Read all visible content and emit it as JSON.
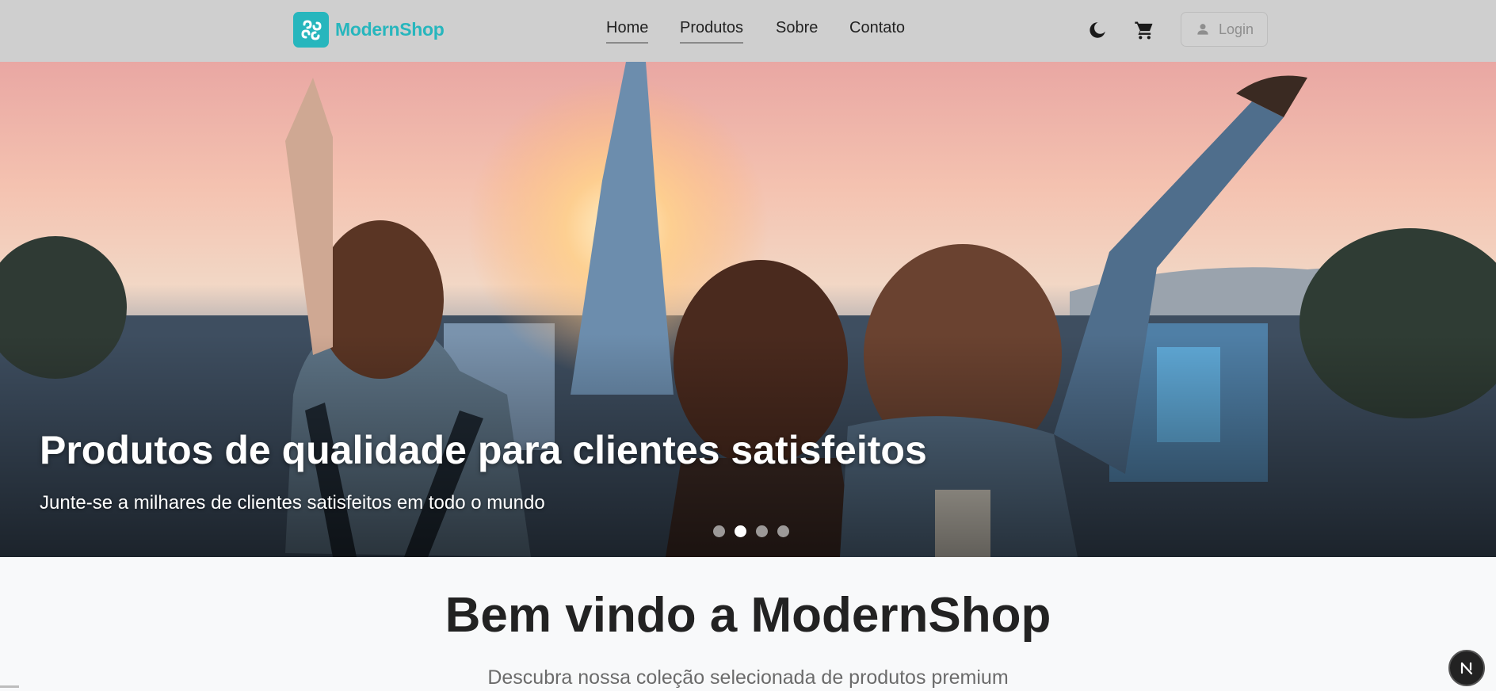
{
  "colors": {
    "navbar_bg": "#cfcfcf",
    "brand": "#27b6bd",
    "page_bg": "#f8f9fa",
    "heading": "#222222",
    "subheading": "#6b6b6b"
  },
  "header": {
    "brand": "ModernShop",
    "nav": [
      "Home",
      "Produtos",
      "Sobre",
      "Contato"
    ],
    "login_label": "Login",
    "icons": [
      "moon-icon",
      "cart-icon",
      "user-icon"
    ]
  },
  "hero": {
    "title": "Produtos de qualidade para clientes satisfeitos",
    "subtitle": "Junte-se a milhares de clientes satisfeitos em todo o mundo",
    "slide_count": 4,
    "active_slide": 2
  },
  "main": {
    "welcome_title": "Bem vindo a ModernShop",
    "welcome_subtitle": "Descubra nossa coleção selecionada de produtos premium"
  }
}
